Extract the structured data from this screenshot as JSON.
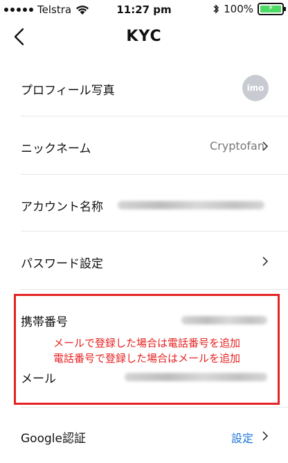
{
  "status_bar": {
    "carrier": "Telstra",
    "time": "11:27 pm",
    "battery_percent": "100%",
    "battery_level": 1.0
  },
  "nav": {
    "title": "KYC"
  },
  "rows": {
    "profile_photo": {
      "label": "プロフィール写真",
      "avatar_text": "imo"
    },
    "nickname": {
      "label": "ニックネーム",
      "value": "Cryptofan"
    },
    "account_name": {
      "label": "アカウント名称"
    },
    "password": {
      "label": "パスワード設定"
    },
    "phone": {
      "label": "携帯番号"
    },
    "email": {
      "label": "メール"
    },
    "google_auth": {
      "label": "Google認証",
      "value": "設定"
    }
  },
  "annotation": {
    "line1": "メールで登録した場合は電話番号を追加",
    "line2": "電話番号で登録した場合はメールを追加",
    "color": "#e52222"
  },
  "colors": {
    "accent": "#1a73d9",
    "battery": "#4cd964"
  }
}
